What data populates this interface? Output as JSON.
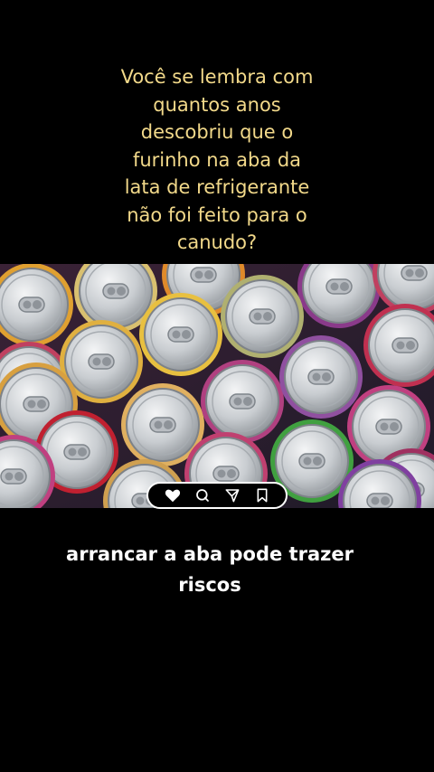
{
  "headline": {
    "lines": [
      "Você se lembra com",
      "quantos anos",
      "descobriu que o",
      "furinho na aba da",
      "lata de refrigerante",
      "não foi feito para o",
      "canudo?"
    ],
    "color": "#f2d98a"
  },
  "photo": {
    "subject_icon": "soda-can-image"
  },
  "action_bar": {
    "icons": [
      "heart-icon",
      "comment-icon",
      "share-icon",
      "bookmark-icon"
    ]
  },
  "caption": {
    "lines": [
      "arrancar a aba pode trazer",
      "riscos"
    ],
    "color": "#ffffff"
  }
}
